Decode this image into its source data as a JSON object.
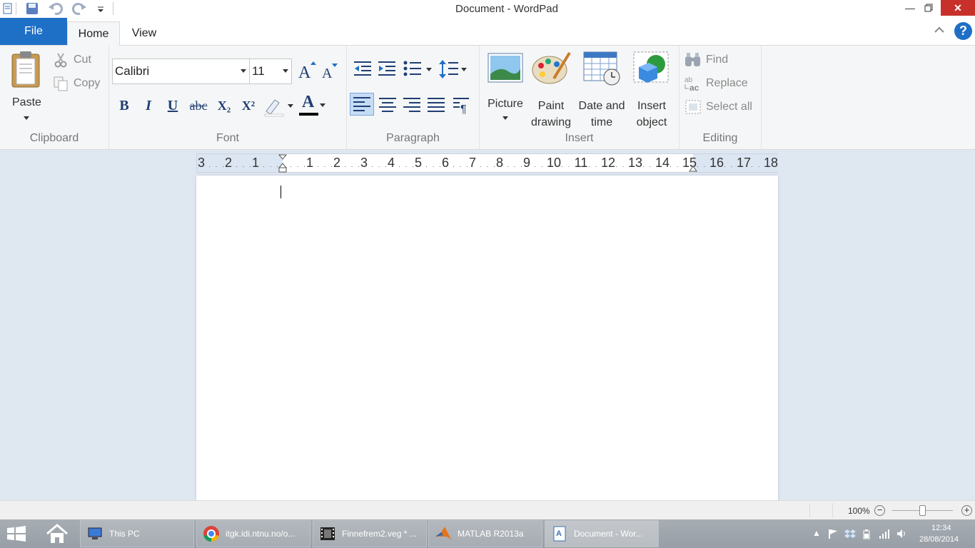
{
  "window": {
    "title": "Document - WordPad"
  },
  "tabs": {
    "file": "File",
    "home": "Home",
    "view": "View"
  },
  "clipboard": {
    "paste": "Paste",
    "cut": "Cut",
    "copy": "Copy",
    "label": "Clipboard"
  },
  "font": {
    "family": "Calibri",
    "size": "11",
    "label": "Font",
    "bold": "B",
    "italic": "I",
    "underline": "U",
    "strike": "abc",
    "subscript": "X₂",
    "superscript": "X²",
    "font_color_glyph": "A"
  },
  "paragraph": {
    "label": "Paragraph"
  },
  "insert": {
    "picture": "Picture",
    "paint_1": "Paint",
    "paint_2": "drawing",
    "datetime_1": "Date and",
    "datetime_2": "time",
    "object_1": "Insert",
    "object_2": "object",
    "label": "Insert"
  },
  "editing": {
    "find": "Find",
    "replace": "Replace",
    "select_all": "Select all",
    "label": "Editing"
  },
  "ruler": {
    "labels": [
      "3",
      "2",
      "1",
      "1",
      "2",
      "3",
      "4",
      "5",
      "6",
      "7",
      "8",
      "9",
      "10",
      "11",
      "12",
      "13",
      "14",
      "15",
      "16",
      "17",
      "18"
    ]
  },
  "status": {
    "zoom": "100%"
  },
  "taskbar": {
    "items": [
      "This PC",
      "itgk.idi.ntnu.no/o...",
      "Finnefrem2.veg * ...",
      "MATLAB R2013a",
      "Document - Wor..."
    ],
    "time": "12:34",
    "date": "28/08/2014"
  },
  "colors": {
    "accent": "#1e6fc6",
    "close": "#c7312a",
    "workspace": "#dfe7f1"
  }
}
